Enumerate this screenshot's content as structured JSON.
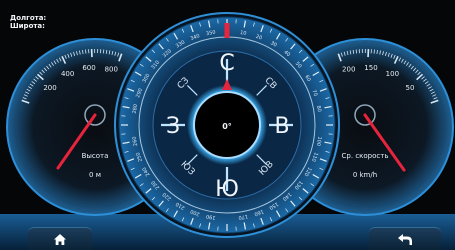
{
  "status": {
    "longitude_label": "Долгота:",
    "latitude_label": "Широта:"
  },
  "altimeter": {
    "ticks": [
      "200",
      "400",
      "600",
      "800"
    ],
    "title": "Высота",
    "value": "0 м"
  },
  "speedometer": {
    "ticks": [
      "50",
      "100",
      "150",
      "200"
    ],
    "title": "Ср. скорость",
    "value": "0 km/h"
  },
  "compass": {
    "heading": "0°",
    "cardinals": {
      "north": "С",
      "east": "В",
      "south": "Ю",
      "west": "З"
    },
    "intercardinals": {
      "ne": "СВ",
      "se": "ЮВ",
      "sw": "ЮЗ",
      "nw": "СЗ"
    },
    "degree_labels": [
      "10",
      "20",
      "30",
      "40",
      "50",
      "60",
      "70",
      "80",
      "90",
      "100",
      "110",
      "120",
      "130",
      "140",
      "150",
      "160",
      "170",
      "180",
      "190",
      "200",
      "210",
      "220",
      "230",
      "240",
      "250",
      "260",
      "270",
      "280",
      "290",
      "300",
      "310",
      "320",
      "330",
      "340",
      "350"
    ]
  },
  "colors": {
    "accent_blue": "#2aa6ff",
    "needle_red": "#e8243c",
    "background": "#050608",
    "panel_bar": "#0d3a66"
  },
  "icons": {
    "home": "home-icon",
    "back": "back-arrow-icon"
  }
}
